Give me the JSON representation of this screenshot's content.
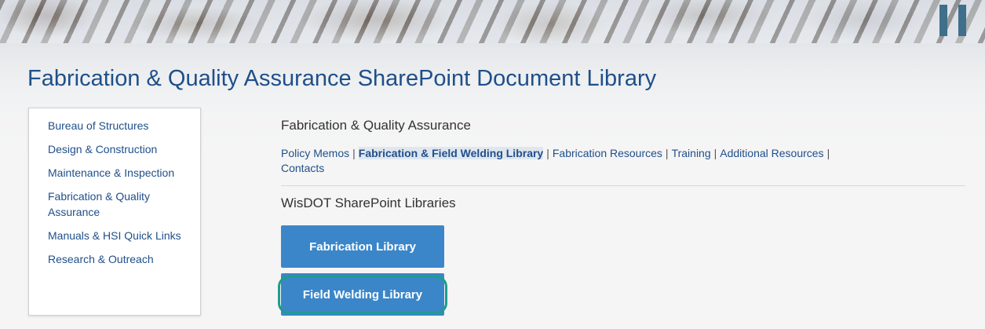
{
  "page_title": "Fabrication & Quality Assurance SharePoint Document Library",
  "sidebar": {
    "items": [
      {
        "label": "Bureau of Structures"
      },
      {
        "label": "Design & Construction"
      },
      {
        "label": "Maintenance & Inspection"
      },
      {
        "label": "Fabrication & Quality Assurance"
      },
      {
        "label": "Manuals & HSI Quick Links"
      },
      {
        "label": "Research & Outreach"
      }
    ]
  },
  "main": {
    "section_heading": "Fabrication & Quality Assurance",
    "nav": [
      {
        "label": "Policy Memos",
        "active": false
      },
      {
        "label": "Fabrication & Field Welding Library",
        "active": true
      },
      {
        "label": "Fabrication Resources",
        "active": false
      },
      {
        "label": "Training",
        "active": false
      },
      {
        "label": "Additional Resources",
        "active": false
      },
      {
        "label": "Contacts",
        "active": false
      }
    ],
    "separator": "|",
    "libraries_heading": "WisDOT SharePoint Libraries",
    "buttons": {
      "fabrication": "Fabrication Library",
      "field_welding": "Field Welding Library"
    }
  },
  "colors": {
    "link": "#1f4f8a",
    "button": "#3b86c9",
    "focus_ring": "#1e9d8a"
  }
}
